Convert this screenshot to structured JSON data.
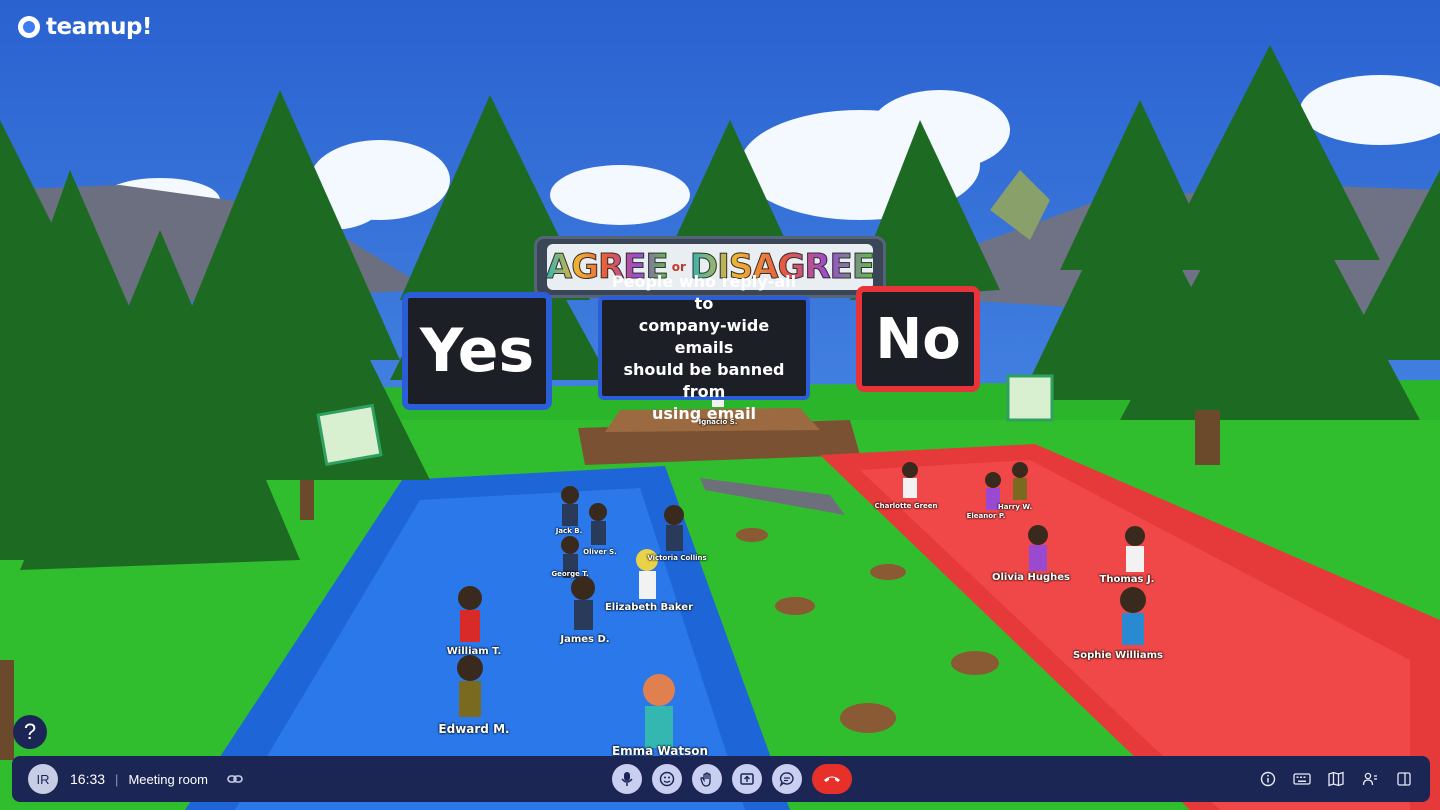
{
  "app": {
    "logo_text": "teamup!"
  },
  "scene": {
    "banner": {
      "agree": "AGREE",
      "or": "or",
      "disagree": "DISAGREE"
    },
    "yes_sign": "Yes",
    "no_sign": "No",
    "question_lines": [
      "People who reply-all to",
      "company-wide emails",
      "should be banned from",
      "using email"
    ],
    "host_label": "Ignacio S.",
    "yes_side_avatars": [
      "Jack B.",
      "Oliver S.",
      "George T.",
      "Victoria Collins",
      "Elizabeth Baker",
      "James D.",
      "William T.",
      "Edward M.",
      "Emma Watson"
    ],
    "no_side_avatars": [
      "Charlotte Green",
      "Eleanor P.",
      "Harry W.",
      "Olivia Hughes",
      "Thomas J.",
      "Sophie Williams"
    ]
  },
  "help_button": {
    "label": "?"
  },
  "bottom_bar": {
    "user_initials": "IR",
    "time": "16:33",
    "separator": "|",
    "room_name": "Meeting room",
    "center_icons": [
      "microphone-icon",
      "emoji-icon",
      "raise-hand-icon",
      "share-screen-icon",
      "chat-icon",
      "end-call-icon"
    ],
    "right_icons": [
      "info-icon",
      "keyboard-icon",
      "map-icon",
      "participants-icon",
      "sidebar-toggle-icon"
    ],
    "colors": {
      "bar_bg": "#1c2654",
      "button_bg": "#c9cff0",
      "end_call": "#e8302b"
    }
  }
}
